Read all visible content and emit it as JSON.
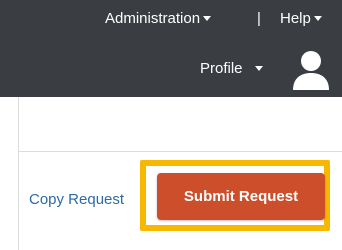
{
  "topbar": {
    "admin_label": "Administration",
    "separator": "|",
    "help_label": "Help",
    "profile_label": "Profile"
  },
  "actions": {
    "copy_label": "Copy Request",
    "submit_label": "Submit Request"
  },
  "colors": {
    "topbar_bg": "#3a3d42",
    "submit_bg": "#cc4e2a",
    "highlight": "#f6b800",
    "link": "#2d6aa6"
  }
}
